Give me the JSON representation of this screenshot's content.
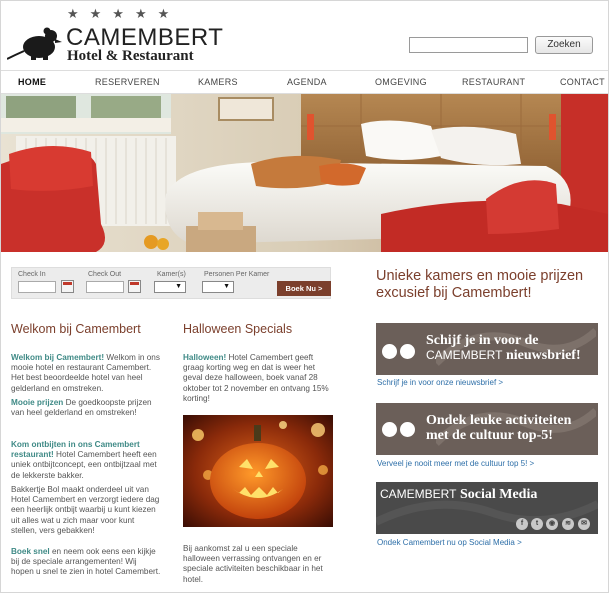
{
  "header": {
    "stars": "★★★★★",
    "logo_name": "CAMEMBERT",
    "logo_sub": "Hotel & Restaurant",
    "search_placeholder": "",
    "search_button": "Zoeken"
  },
  "nav": [
    "HOME",
    "RESERVEREN",
    "KAMERS",
    "AGENDA",
    "OMGEVING",
    "RESTAURANT",
    "CONTACT"
  ],
  "booking": {
    "check_in": "Check In",
    "check_out": "Check Out",
    "kamers": "Kamer(s)",
    "personen": "Personen Per Kamer",
    "button": "Boek Nu >"
  },
  "welcome": {
    "title": "Welkom bij Camembert",
    "p1_bold": "Welkom bij Camembert!",
    "p1_text": " Welkom in ons mooie hotel en restaurant Camembert. Het best beoordeelde hotel van heel gelderland en omstreken.",
    "p2_bold": "Mooie prijzen",
    "p2_text": " De goedkoopste prijzen van heel gelderland en omstreken!",
    "p3_bold": "Kom ontbijten in ons Camembert restaurant!",
    "p3_text": " Hotel Camembert heeft een uniek ontbijtconcept, een ontbijtzaal met de lekkerste bakker.",
    "p4_text": "Bakkertje Bol maakt onderdeel uit van Hotel Camembert en verzorgt iedere dag een heerlijk ontbijt waarbij u kunt kiezen uit alles wat u zich maar voor kunt stellen, vers gebakken!",
    "p5_bold": "Boek snel",
    "p5_text": " en neem ook eens een kijkje bij de speciale arrangementen! Wij hopen u snel te zien in hotel Camembert."
  },
  "halloween": {
    "title": "Halloween Specials",
    "p1_bold": "Halloween!",
    "p1_text": " Hotel Camembert geeft graag korting weg en dat is weer het geval deze halloween, boek vanaf 28 oktober tot 2 november en ontvang 15% korting!",
    "p2_text": "Bij aankomst zal u een speciale halloween verrassing ontvangen en er speciale activiteiten beschikbaar in het hotel."
  },
  "promo": {
    "headline": "Unieke kamers en mooie prijzen excusief bij Camembert!"
  },
  "boxes": [
    {
      "line1": "Schijf je in voor de",
      "line2_brand": "CAMEMBERT",
      "line2_text": " nieuwsbrief!",
      "link": "Schrijf je in voor onze nieuwsbrief >"
    },
    {
      "line1": "Ondek leuke activiteiten",
      "line2_text": "met de cultuur top-5!",
      "link": "Verveel je nooit meer met de cultuur top 5! >"
    },
    {
      "line1_brand": "CAMEMBERT",
      "line1_text": " Social Media",
      "link": "Ondek Camembert nu op Social Media >"
    }
  ],
  "colors": {
    "accent": "#7b3f2c",
    "teal": "#3f8a86",
    "link": "#2e6fa8",
    "box": "#6b5f59",
    "social_box": "#4a4a4a"
  }
}
